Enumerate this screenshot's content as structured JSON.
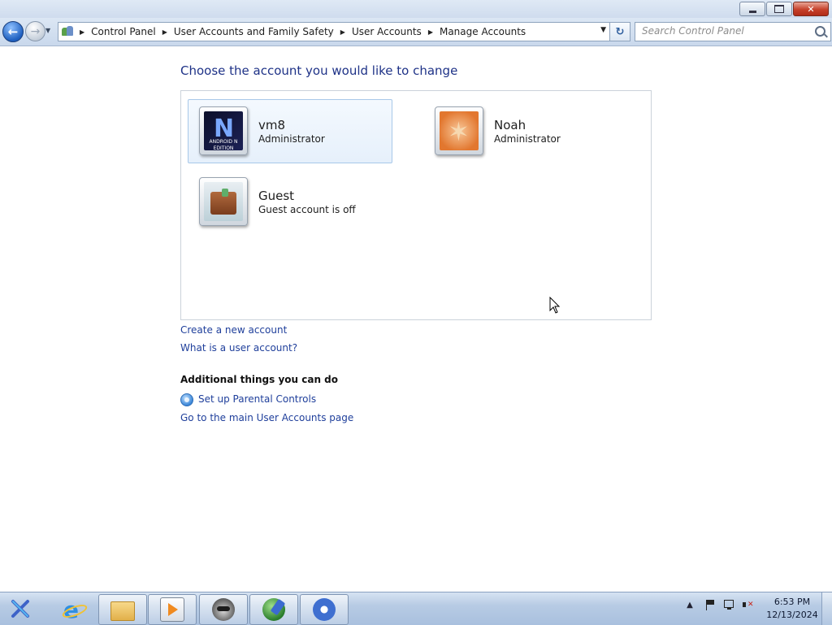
{
  "window": {
    "minimize_glyph": "–",
    "maximize_glyph": "□",
    "close_glyph": "✕"
  },
  "navigation": {
    "back_glyph": "←",
    "forward_glyph": "→",
    "breadcrumb": [
      "Control Panel",
      "User Accounts and Family Safety",
      "User Accounts",
      "Manage Accounts"
    ],
    "search_placeholder": "Search Control Panel",
    "refresh_glyph": "↻"
  },
  "main": {
    "title": "Choose the account you would like to change",
    "accounts": [
      {
        "name": "vm8",
        "role": "Administrator",
        "picture": "android-n-edition-picture",
        "selected": true,
        "picture_letter": "N",
        "picture_caption": "ANDROID N EDITION"
      },
      {
        "name": "Noah",
        "role": "Administrator",
        "picture": "starfish-picture",
        "selected": false
      },
      {
        "name": "Guest",
        "role": "Guest account is off",
        "picture": "suitcase-picture",
        "selected": false
      }
    ],
    "links": {
      "create_account": "Create a new account",
      "what_is_account": "What is a user account?"
    },
    "additional": {
      "heading": "Additional things you can do",
      "parental_controls": "Set up Parental Controls",
      "main_accounts_page": "Go to the main User Accounts page"
    }
  },
  "taskbar": {
    "apps": [
      {
        "name": "start-button",
        "icon": "start-orb-icon",
        "label": "X"
      },
      {
        "name": "internet-explorer",
        "icon": "internet-explorer-icon"
      },
      {
        "name": "windows-explorer",
        "icon": "folder-icon"
      },
      {
        "name": "media-player",
        "icon": "media-player-icon"
      },
      {
        "name": "raccoon-app",
        "icon": "raccoon-icon"
      },
      {
        "name": "download-manager",
        "icon": "globe-icon"
      },
      {
        "name": "control-panel",
        "icon": "gear-icon"
      }
    ],
    "tray": {
      "show_hidden_glyph": "▲",
      "time": "6:53 PM",
      "date": "12/13/2024"
    }
  },
  "colors": {
    "title_text": "#1e3287",
    "link_text": "#1f3f9b",
    "selected_tile_border": "#a8c8e9",
    "panel_border": "#cbd2da",
    "taskbar": "#b7cbe4"
  }
}
